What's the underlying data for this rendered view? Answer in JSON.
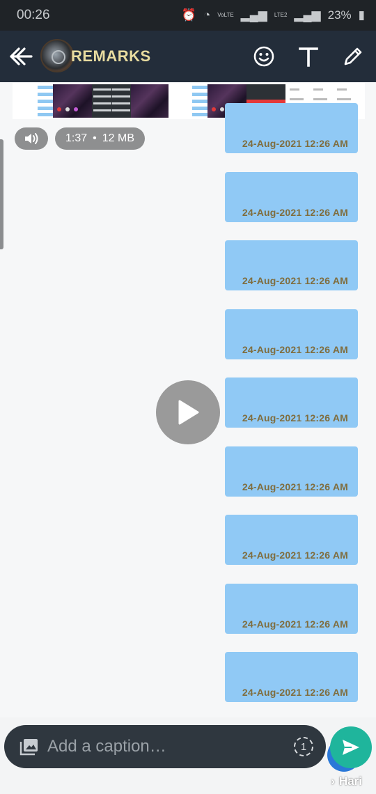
{
  "status_bar": {
    "time": "00:26",
    "battery": "23%",
    "net1": "VoLTE",
    "net2": "LTE2"
  },
  "header": {
    "title": "REMARKS"
  },
  "video_info": {
    "duration": "1:37",
    "separator": "•",
    "size": "12 MB"
  },
  "messages": [
    {
      "time": "24-Aug-2021 12:26 AM"
    },
    {
      "time": "24-Aug-2021 12:26 AM"
    },
    {
      "time": "24-Aug-2021 12:26 AM"
    },
    {
      "time": "24-Aug-2021 12:26 AM"
    },
    {
      "time": "24-Aug-2021 12:26 AM"
    },
    {
      "time": "24-Aug-2021 12:26 AM"
    },
    {
      "time": "24-Aug-2021 12:26 AM"
    },
    {
      "time": "24-Aug-2021 12:26 AM"
    },
    {
      "time": "24-Aug-2021 12:26 AM"
    }
  ],
  "composer": {
    "placeholder": "Add a caption…",
    "view_once": "1"
  },
  "recipient": {
    "name": "Hari"
  },
  "colors": {
    "app_bar": "#232d3a",
    "bubble": "#90c9f5",
    "send": "#1fb59c",
    "title": "#e8dca0"
  }
}
